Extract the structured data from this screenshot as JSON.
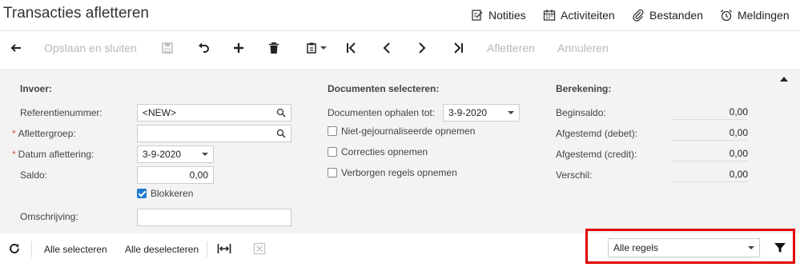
{
  "header": {
    "title": "Transacties afletteren",
    "links": {
      "notes": "Notities",
      "activities": "Activiteiten",
      "files": "Bestanden",
      "notifications": "Meldingen"
    }
  },
  "toolbar": {
    "save_close": "Opslaan en sluiten",
    "reconcile": "Afletteren",
    "cancel": "Annuleren"
  },
  "invoer": {
    "section": "Invoer:",
    "ref_label": "Referentienummer:",
    "ref_value": "<NEW>",
    "group_label": "Aflettergroep:",
    "group_value": "",
    "date_label": "Datum aflettering:",
    "date_value": "3-9-2020",
    "saldo_label": "Saldo:",
    "saldo_value": "0,00",
    "block_label": "Blokkeren",
    "desc_label": "Omschrijving:",
    "desc_value": ""
  },
  "documenten": {
    "section": "Documenten selecteren:",
    "fetch_label": "Documenten ophalen tot:",
    "fetch_value": "3-9-2020",
    "cb1": "Niet-gejournaliseerde opnemen",
    "cb2": "Correcties opnemen",
    "cb3": "Verborgen regels opnemen"
  },
  "berekening": {
    "section": "Berekening:",
    "begin_label": "Beginsaldo:",
    "begin_value": "0,00",
    "debit_label": "Afgestemd (debet):",
    "debit_value": "0,00",
    "credit_label": "Afgestemd (credit):",
    "credit_value": "0,00",
    "diff_label": "Verschil:",
    "diff_value": "0,00"
  },
  "grid_toolbar": {
    "select_all": "Alle selecteren",
    "deselect_all": "Alle deselecteren",
    "filter_value": "Alle regels"
  },
  "colors": {
    "highlight": "#e10000",
    "accent": "#1f78d1",
    "disabled_text": "#b8b8b8"
  }
}
